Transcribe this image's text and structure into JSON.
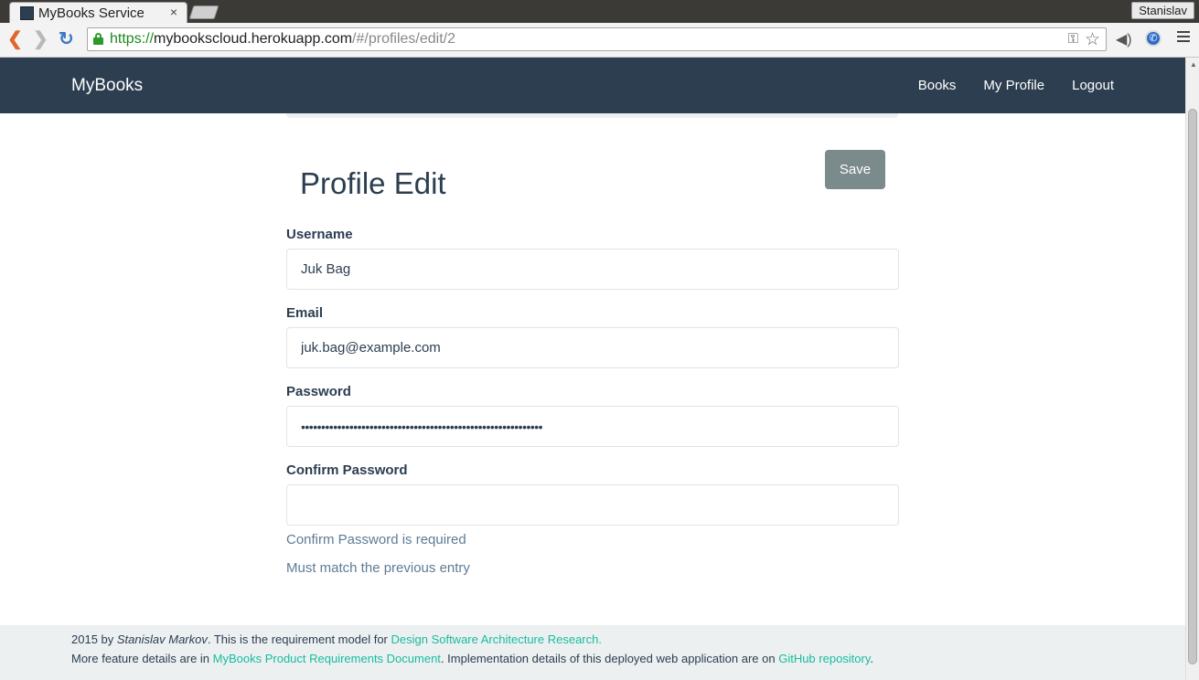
{
  "browser": {
    "tab_title": "MyBooks Service",
    "tab_close": "×",
    "profile_name": "Stanislav",
    "url_scheme": "https://",
    "url_host": "mybookscloud.herokuapp.com",
    "url_path": "/#/profiles/edit/2"
  },
  "navbar": {
    "brand": "MyBooks",
    "links": [
      "Books",
      "My Profile",
      "Logout"
    ]
  },
  "page": {
    "title": "Profile Edit",
    "save_label": "Save"
  },
  "form": {
    "username_label": "Username",
    "username_value": "Juk Bag",
    "email_label": "Email",
    "email_value": "juk.bag@example.com",
    "password_label": "Password",
    "password_masked": "••••••••••••••••••••••••••••••••••••••••••••••••••••••••••••",
    "confirm_label": "Confirm Password",
    "confirm_value": "",
    "error_required": "Confirm Password is required",
    "error_match": "Must match the previous entry"
  },
  "footer": {
    "line1_prefix": "2015 by ",
    "author": "Stanislav Markov",
    "line1_middle": ". This is the requirement model for ",
    "link_research": "Design Software Architecture Research.",
    "line2_prefix": "More feature details are in ",
    "link_prd": "MyBooks Product Requirements Document",
    "line2_middle": ". Implementation details of this deployed web application are on ",
    "link_github": "GitHub repository",
    "line2_suffix": "."
  },
  "colors": {
    "navbar_bg": "#2c3e50",
    "accent_link": "#18bc9c",
    "save_button": "#7b8a8b",
    "error_text": "#5d7b95"
  }
}
